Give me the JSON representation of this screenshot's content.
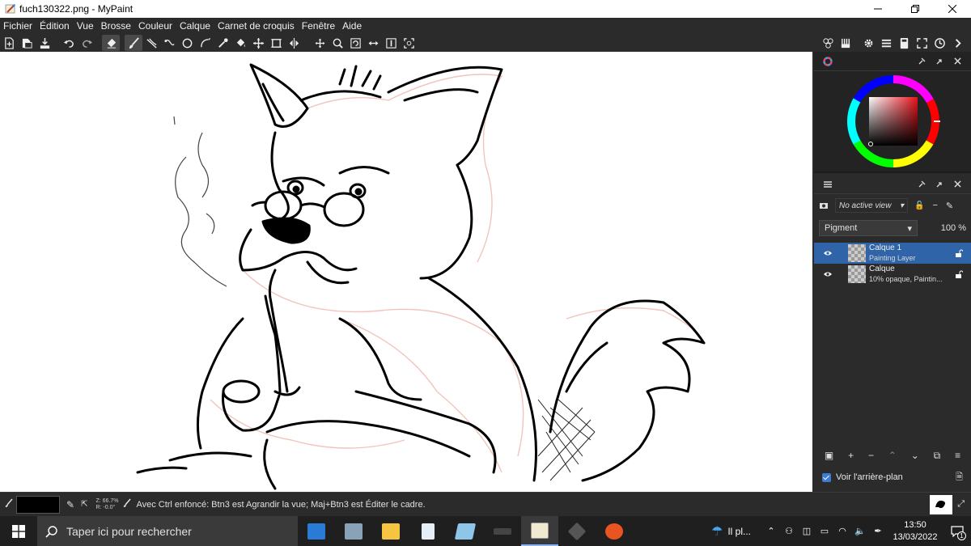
{
  "window": {
    "title": "fuch130322.png - MyPaint"
  },
  "menu": [
    "Fichier",
    "Édition",
    "Vue",
    "Brosse",
    "Couleur",
    "Calque",
    "Carnet de croquis",
    "Fenêtre",
    "Aide"
  ],
  "toolbar": {
    "left_icons": [
      "new-document-icon",
      "open-icon",
      "save-icon",
      "undo-icon",
      "redo-icon",
      "eraser-icon",
      "brush-icon",
      "freehand-icon",
      "line-icon",
      "ellipse-icon",
      "inking-icon",
      "color-picker-icon",
      "fill-icon",
      "move-icon",
      "frame-icon",
      "pan-icon",
      "zoom-icon",
      "rotate-icon",
      "mirror-icon",
      "reset-view-icon",
      "fit-view-icon"
    ],
    "right_icons": [
      "brush-settings-icon",
      "color-settings-icon",
      "preferences-icon",
      "layers-panel-icon",
      "scratchpad-icon",
      "fullscreen-icon",
      "history-icon",
      "more-icon"
    ]
  },
  "layers_panel": {
    "view_select": "No active view",
    "blend_mode": "Pigment",
    "opacity": "100 %",
    "layers": [
      {
        "name": "Calque 1",
        "subtitle": "Painting Layer",
        "selected": true
      },
      {
        "name": "Calque",
        "subtitle": "10% opaque, Paintin...",
        "selected": false
      }
    ],
    "show_background_label": "Voir l'arrière-plan"
  },
  "statusbar": {
    "zoom": "Z: 66.7%",
    "rotation": "R: -0.0°",
    "message": "Avec Ctrl enfoncé: Btn3 est Agrandir la vue;  Maj+Btn3 est Éditer le cadre.",
    "current_color": "#000000"
  },
  "taskbar": {
    "search_placeholder": "Taper ici pour rechercher",
    "weather_label": "Il pl...",
    "time": "13:50",
    "date": "13/03/2022",
    "notification_count": "1"
  },
  "colors": {
    "selection": "#2f64a8",
    "panel_bg": "#2b2b2b",
    "canvas_bg": "#ffffff"
  }
}
